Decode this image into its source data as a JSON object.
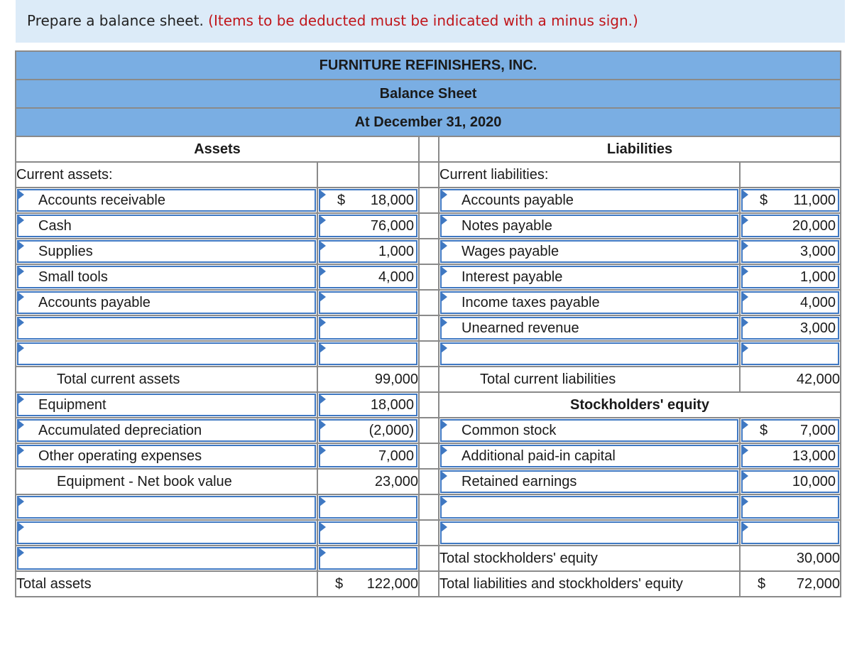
{
  "prompt": {
    "instruction": "Prepare a balance sheet.",
    "note": "(Items to be deducted must be indicated with a minus sign.)"
  },
  "header": {
    "company": "FURNITURE REFINISHERS, INC.",
    "statement": "Balance Sheet",
    "date": "At December 31, 2020"
  },
  "assets": {
    "title": "Assets",
    "current_label": "Current assets:",
    "current_items": [
      {
        "label": "Accounts receivable",
        "currency": "$",
        "amount": "18,000"
      },
      {
        "label": "Cash",
        "currency": "",
        "amount": "76,000"
      },
      {
        "label": "Supplies",
        "currency": "",
        "amount": "1,000"
      },
      {
        "label": "Small tools",
        "currency": "",
        "amount": "4,000"
      },
      {
        "label": "Accounts payable",
        "currency": "",
        "amount": ""
      },
      {
        "label": "",
        "currency": "",
        "amount": ""
      },
      {
        "label": "",
        "currency": "",
        "amount": ""
      }
    ],
    "total_current_label": "Total current assets",
    "total_current_amount": "99,000",
    "noncurrent_items": [
      {
        "label": "Equipment",
        "amount": "18,000"
      },
      {
        "label": "Accumulated depreciation",
        "amount": "(2,000)"
      },
      {
        "label": "Other operating expenses",
        "amount": "7,000"
      }
    ],
    "net_book_label": "Equipment - Net book value",
    "net_book_amount": "23,000",
    "extra_items": [
      {
        "label": "",
        "amount": ""
      },
      {
        "label": "",
        "amount": ""
      },
      {
        "label": "",
        "amount": ""
      }
    ],
    "total_label": "Total assets",
    "total_currency": "$",
    "total_amount": "122,000"
  },
  "liabilities": {
    "title": "Liabilities",
    "current_label": "Current liabilities:",
    "current_items": [
      {
        "label": "Accounts payable",
        "currency": "$",
        "amount": "11,000"
      },
      {
        "label": "Notes payable",
        "currency": "",
        "amount": "20,000"
      },
      {
        "label": "Wages payable",
        "currency": "",
        "amount": "3,000"
      },
      {
        "label": "Interest payable",
        "currency": "",
        "amount": "1,000"
      },
      {
        "label": "Income taxes payable",
        "currency": "",
        "amount": "4,000"
      },
      {
        "label": "Unearned revenue",
        "currency": "",
        "amount": "3,000"
      },
      {
        "label": "",
        "currency": "",
        "amount": ""
      }
    ],
    "total_current_label": "Total current liabilities",
    "total_current_amount": "42,000"
  },
  "equity": {
    "title": "Stockholders' equity",
    "items": [
      {
        "label": "Common stock",
        "currency": "$",
        "amount": "7,000"
      },
      {
        "label": "Additional paid-in capital",
        "currency": "",
        "amount": "13,000"
      },
      {
        "label": "Retained earnings",
        "currency": "",
        "amount": "10,000"
      },
      {
        "label": "",
        "currency": "",
        "amount": ""
      },
      {
        "label": "",
        "currency": "",
        "amount": ""
      }
    ],
    "total_label": "Total stockholders' equity",
    "total_amount": "30,000",
    "grand_total_label": "Total liabilities and stockholders' equity",
    "grand_total_currency": "$",
    "grand_total_amount": "72,000"
  }
}
